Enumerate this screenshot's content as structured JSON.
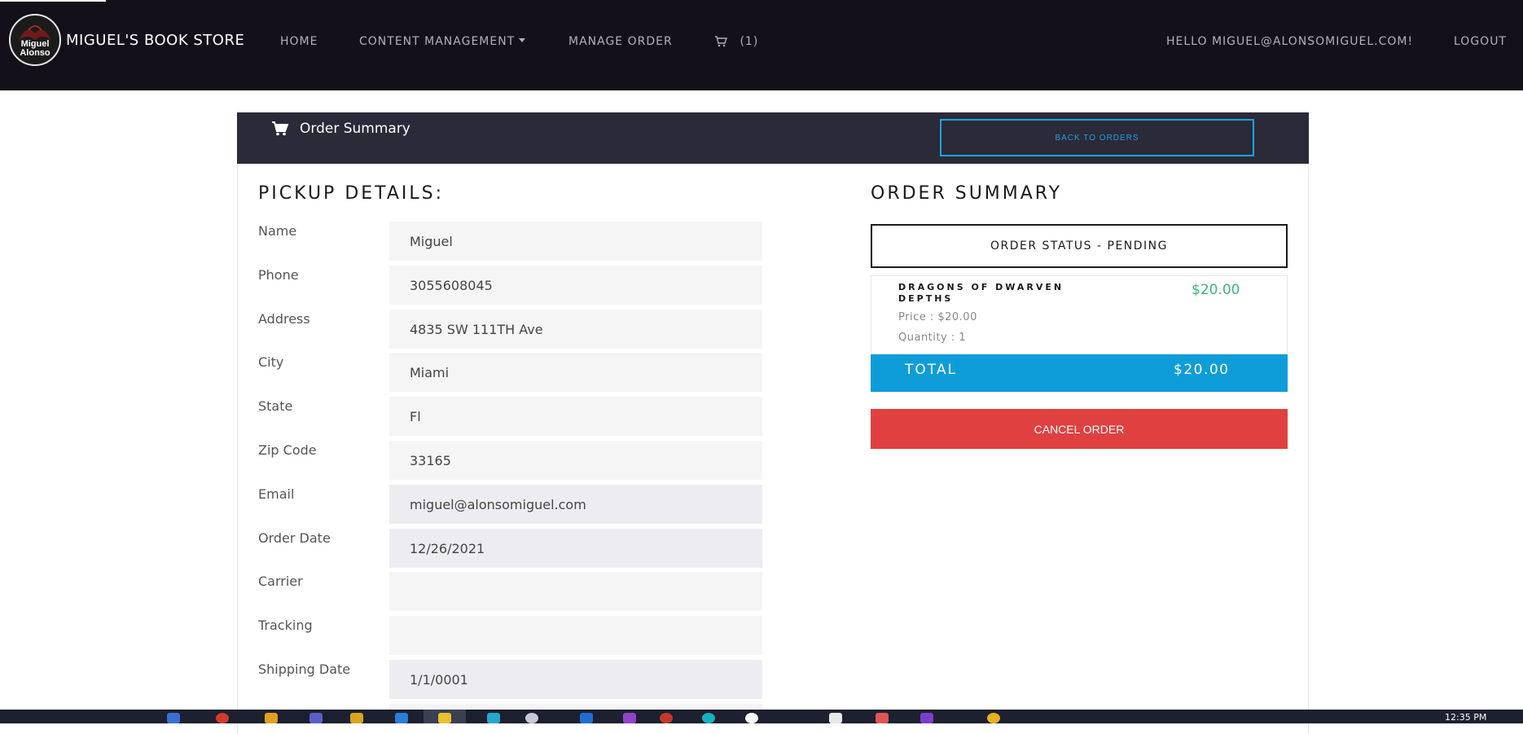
{
  "navbar": {
    "logo_text_line1": "Miguel",
    "logo_text_line2": "Alonso",
    "brand": "MIGUEL'S BOOK STORE",
    "links": {
      "home": "HOME",
      "content_management": "CONTENT MANAGEMENT",
      "manage_order": "MANAGE ORDER",
      "cart_count": "(1)"
    },
    "greeting": "HELLO MIGUEL@ALONSOMIGUEL.COM!",
    "logout": "LOGOUT"
  },
  "card_header": {
    "title": "Order Summary",
    "back_button": "BACK TO ORDERS"
  },
  "pickup": {
    "title": "PICKUP DETAILS:",
    "fields": [
      {
        "label": "Name",
        "value": "Miguel"
      },
      {
        "label": "Phone",
        "value": "3055608045"
      },
      {
        "label": "Address",
        "value": "4835 SW 111TH Ave"
      },
      {
        "label": "City",
        "value": "Miami"
      },
      {
        "label": "State",
        "value": "Fl"
      },
      {
        "label": "Zip Code",
        "value": "33165"
      },
      {
        "label": "Email",
        "value": "miguel@alonsomiguel.com"
      },
      {
        "label": "Order Date",
        "value": "12/26/2021"
      },
      {
        "label": "Carrier",
        "value": ""
      },
      {
        "label": "Tracking",
        "value": ""
      },
      {
        "label": "Shipping Date",
        "value": "1/1/0001"
      }
    ]
  },
  "summary": {
    "title": "ORDER SUMMARY",
    "status": "ORDER STATUS - PENDING",
    "item": {
      "title": "DRAGONS OF DWARVEN DEPTHS",
      "price_right": "$20.00",
      "price": "Price : $20.00",
      "quantity": "Quantity : 1"
    },
    "total_label": "TOTAL",
    "total_value": "$20.00",
    "cancel_button": "CANCEL ORDER"
  },
  "taskbar": {
    "clock": "12:35 PM"
  },
  "colors": {
    "navbar": "#14101a",
    "card_header": "#2b2a38",
    "accent_blue": "#0f9dd9",
    "cancel_red": "#e04040",
    "price_green": "#3cb878"
  }
}
